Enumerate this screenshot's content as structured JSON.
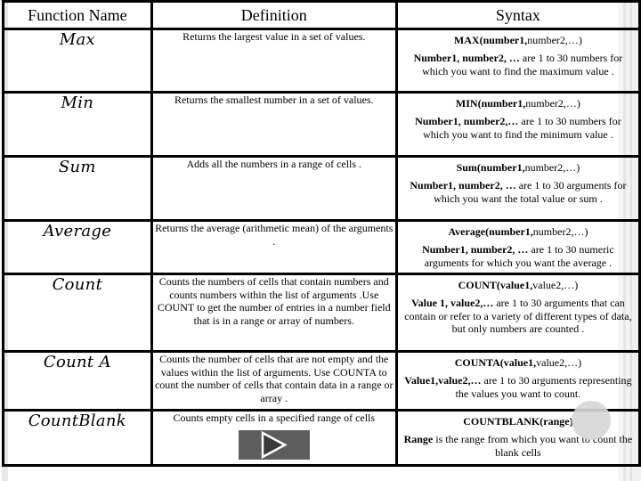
{
  "table": {
    "headers": [
      "Function Name",
      "Definition",
      "Syntax"
    ],
    "rows": [
      {
        "name": "Max",
        "definition": "Returns the largest value in a set of values.",
        "syntax_bold": "MAX(number1,",
        "syntax_rest": "number2,…)",
        "desc_bold": "Number1, number2, …",
        "desc_rest": " are 1 to 30 numbers for which you want to find the maximum value ."
      },
      {
        "name": "Min",
        "definition": "Returns the smallest number in a set of values.",
        "syntax_bold": "MIN(number1,",
        "syntax_rest": "number2,…)",
        "desc_bold": "Number1, number2,…",
        "desc_rest": " are 1 to 30 numbers for which you want to find the minimum value ."
      },
      {
        "name": "Sum",
        "definition": "Adds all the numbers in a range of cells .",
        "syntax_bold": "Sum(number1,",
        "syntax_rest": "number2,…)",
        "desc_bold": "Number1, number2, …",
        "desc_rest": " are 1 to 30 arguments for which you want the total value or sum ."
      },
      {
        "name": "Average",
        "definition": "Returns the average (arithmetic mean) of the arguments .",
        "syntax_bold": "Average(number1,",
        "syntax_rest": "number2,…)",
        "desc_bold": "Number1, number2, …",
        "desc_rest": " are 1 to 30 numeric arguments for which you want the average ."
      },
      {
        "name": "Count",
        "definition": "Counts the numbers of cells that contain numbers and counts numbers within the list of arguments .Use COUNT to get the number of entries in a number field that is in a range or array of numbers.",
        "syntax_bold": "COUNT(value1,",
        "syntax_rest": "value2,…)",
        "desc_bold": "Value 1, value2,…",
        "desc_rest": " are 1 to 30 arguments that can contain or refer to a variety of different types of data, but only numbers are counted ."
      },
      {
        "name": "Count A",
        "definition": "Counts the number of cells that are not empty and the values within the list of arguments. Use COUNTA to count the number of cells that contain data in a range or array .",
        "syntax_bold": "COUNTA(value1,",
        "syntax_rest": "value2,…)",
        "desc_bold": "Value1,value2,…",
        "desc_rest": " are 1 to 30 arguments representing the values you want to count."
      },
      {
        "name": "CountBlank",
        "definition": "Counts empty cells in a specified range of cells",
        "syntax_bold": "COUNTBLANK(range)",
        "syntax_rest": "",
        "desc_bold": "Range",
        "desc_rest": " is the range from which you want to count the blank cells"
      }
    ]
  },
  "controls": {
    "play_button_icon": "play-triangle-icon"
  }
}
